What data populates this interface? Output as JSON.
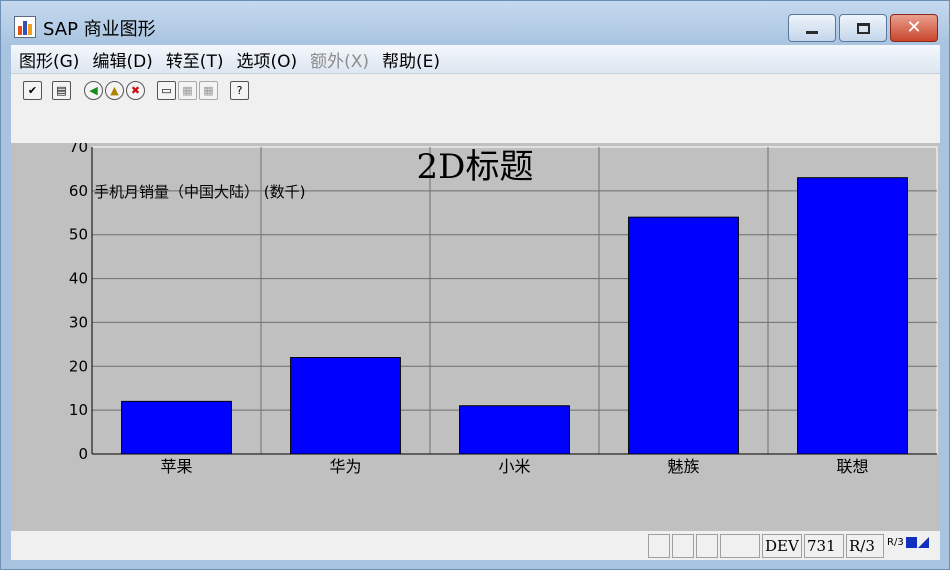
{
  "window": {
    "title": "SAP 商业图形",
    "controls": {
      "minimize": "minimize",
      "maximize": "maximize",
      "close": "✕"
    }
  },
  "menu": [
    {
      "label": "图形(G)",
      "enabled": true
    },
    {
      "label": "编辑(D)",
      "enabled": true
    },
    {
      "label": "转至(T)",
      "enabled": true
    },
    {
      "label": "选项(O)",
      "enabled": true
    },
    {
      "label": "额外(X)",
      "enabled": false
    },
    {
      "label": "帮助(E)",
      "enabled": true
    }
  ],
  "toolbar": [
    {
      "icon": "check-icon",
      "glyph": "✔",
      "enabled": true
    },
    {
      "icon": "save-icon",
      "glyph": "▤",
      "enabled": true
    },
    {
      "icon": "back-icon",
      "glyph": "◀",
      "enabled": true
    },
    {
      "icon": "exit-icon",
      "glyph": "▲",
      "enabled": true
    },
    {
      "icon": "cancel-icon",
      "glyph": "✖",
      "enabled": true
    },
    {
      "icon": "print-icon",
      "glyph": "▭",
      "enabled": true
    },
    {
      "icon": "find-icon",
      "glyph": "▦",
      "enabled": false
    },
    {
      "icon": "find-next-icon",
      "glyph": "▦",
      "enabled": false
    },
    {
      "icon": "help-icon",
      "glyph": "?",
      "enabled": true
    }
  ],
  "chart_data": {
    "type": "bar",
    "title": "2D标题",
    "ylabel": "手机月销量（中国大陆） (数千)",
    "categories": [
      "苹果",
      "华为",
      "小米",
      "魅族",
      "联想"
    ],
    "values": [
      12,
      22,
      11,
      54,
      63
    ],
    "ylim": [
      0,
      70
    ],
    "yticks": [
      0,
      10,
      20,
      30,
      40,
      50,
      60,
      70
    ],
    "grid": true,
    "bar_color": "#0000ff",
    "background": "#c0c0c0"
  },
  "status": {
    "fields": [
      "",
      "",
      "",
      ""
    ],
    "system": "DEV",
    "client": "731",
    "release": "R/3",
    "logo": "R/3"
  },
  "colors": {
    "titlebar": "#a9c4e0",
    "close_button": "#c9452c",
    "disabled_text": "#8d8d8d"
  }
}
